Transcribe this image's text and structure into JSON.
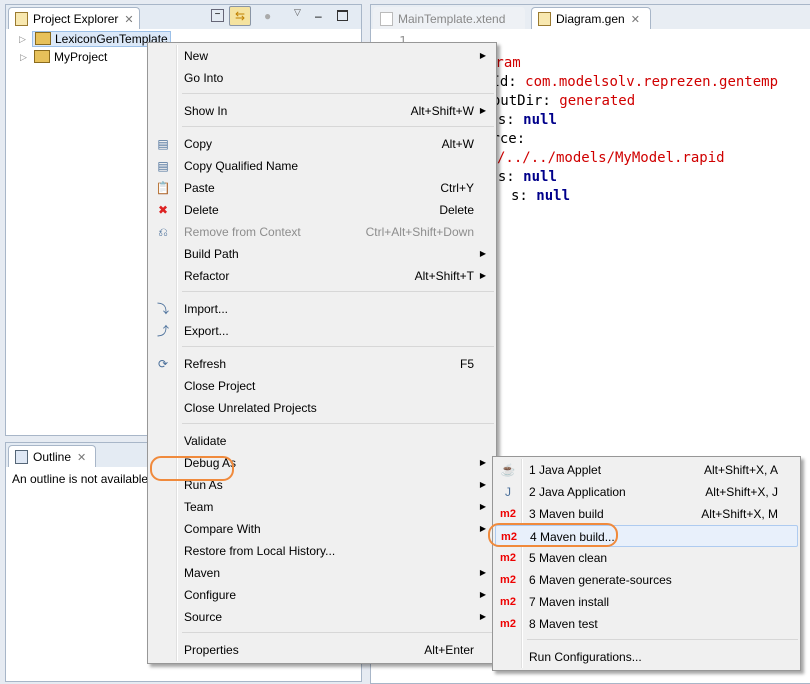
{
  "explorer": {
    "tab": "Project Explorer",
    "items": [
      {
        "label": "LexiconGenTemplate",
        "selected": true
      },
      {
        "label": "MyProject"
      }
    ]
  },
  "outline": {
    "tab": "Outline",
    "message": "An outline is not available."
  },
  "editor": {
    "tabs": [
      {
        "label": "MainTemplate.xtend",
        "active": false
      },
      {
        "label": "Diagram.gen",
        "active": true
      }
    ],
    "line_number": "1",
    "lines": [
      {
        "parts": [
          {
            "t": "---",
            "c": ""
          }
        ]
      },
      {
        "parts": [
          {
            "t": "gram",
            "c": "red"
          }
        ]
      },
      {
        "parts": [
          {
            "t": "eId: ",
            "c": ""
          },
          {
            "t": "com.modelsolv.reprezen.gentemp",
            "c": "red"
          }
        ]
      },
      {
        "parts": [
          {
            "t": "utputDir: ",
            "c": ""
          },
          {
            "t": "generated",
            "c": "red"
          }
        ]
      },
      {
        "parts": [
          {
            "t": "tes: ",
            "c": ""
          },
          {
            "t": "null",
            "c": "kw"
          }
        ]
      },
      {
        "parts": [
          {
            "t": "urce:",
            "c": ""
          }
        ]
      },
      {
        "parts": [
          {
            "t": "/../../models/MyModel.rapid",
            "c": "red"
          }
        ]
      },
      {
        "parts": [
          {
            "t": "tes: ",
            "c": ""
          },
          {
            "t": "null",
            "c": "kw"
          }
        ]
      },
      {
        "parts": [
          {
            "t": "s: ",
            "c": ""
          },
          {
            "t": "null",
            "c": "kw"
          }
        ]
      }
    ]
  },
  "context_menu": {
    "groups": [
      [
        {
          "label": "New",
          "submenu": true
        },
        {
          "label": "Go Into"
        }
      ],
      [
        {
          "label": "Show In",
          "shortcut": "Alt+Shift+W",
          "submenu": true
        }
      ],
      [
        {
          "label": "Copy",
          "shortcut": "Alt+W",
          "icon": "copy-icon"
        },
        {
          "label": "Copy Qualified Name",
          "icon": "copy-qualified-icon"
        },
        {
          "label": "Paste",
          "shortcut": "Ctrl+Y",
          "icon": "paste-icon"
        },
        {
          "label": "Delete",
          "shortcut": "Delete",
          "icon": "delete-icon"
        },
        {
          "label": "Remove from Context",
          "shortcut": "Ctrl+Alt+Shift+Down",
          "icon": "remove-context-icon",
          "disabled": true
        },
        {
          "label": "Build Path",
          "submenu": true
        },
        {
          "label": "Refactor",
          "shortcut": "Alt+Shift+T",
          "submenu": true
        }
      ],
      [
        {
          "label": "Import...",
          "icon": "import-icon"
        },
        {
          "label": "Export...",
          "icon": "export-icon"
        }
      ],
      [
        {
          "label": "Refresh",
          "shortcut": "F5",
          "icon": "refresh-icon"
        },
        {
          "label": "Close Project"
        },
        {
          "label": "Close Unrelated Projects"
        }
      ],
      [
        {
          "label": "Validate"
        },
        {
          "label": "Debug As",
          "submenu": true
        },
        {
          "label": "Run As",
          "submenu": true,
          "highlighted": true
        },
        {
          "label": "Team",
          "submenu": true
        },
        {
          "label": "Compare With",
          "submenu": true
        },
        {
          "label": "Restore from Local History..."
        },
        {
          "label": "Maven",
          "submenu": true
        },
        {
          "label": "Configure",
          "submenu": true
        },
        {
          "label": "Source",
          "submenu": true
        }
      ],
      [
        {
          "label": "Properties",
          "shortcut": "Alt+Enter"
        }
      ]
    ]
  },
  "run_as_menu": {
    "groups": [
      [
        {
          "label": "1 Java Applet",
          "shortcut": "Alt+Shift+X, A",
          "icon": "java-applet-icon"
        },
        {
          "label": "2 Java Application",
          "shortcut": "Alt+Shift+X, J",
          "icon": "java-application-icon"
        },
        {
          "label": "3 Maven build",
          "shortcut": "Alt+Shift+X, M",
          "icon": "m2"
        },
        {
          "label": "4 Maven build...",
          "icon": "m2",
          "highlighted": true
        },
        {
          "label": "5 Maven clean",
          "icon": "m2"
        },
        {
          "label": "6 Maven generate-sources",
          "icon": "m2"
        },
        {
          "label": "7 Maven install",
          "icon": "m2"
        },
        {
          "label": "8 Maven test",
          "icon": "m2"
        }
      ],
      [
        {
          "label": "Run Configurations..."
        }
      ]
    ]
  },
  "colors": {
    "highlight_ring": "#f08a3c",
    "m2": "#e00000",
    "string": "#d00000",
    "keyword": "#00008b"
  }
}
